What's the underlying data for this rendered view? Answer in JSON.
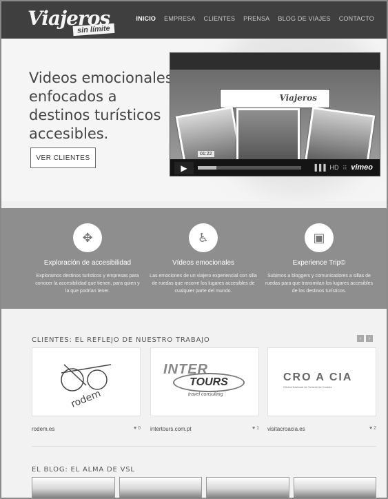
{
  "nav": {
    "logo_text": "Viajeros",
    "logo_tagline": "sin límite",
    "items": [
      "INICIO",
      "EMPRESA",
      "CLIENTES",
      "PRENSA",
      "BLOG DE VIAJES",
      "CONTACTO"
    ],
    "active_index": 0
  },
  "hero": {
    "title": "Videos emocionales enfocados a destinos turísticos accesibles.",
    "button_label": "VER CLIENTES"
  },
  "video": {
    "badge_text": "Viajeros",
    "time": "01:22",
    "progress": 0.18,
    "brand": "vimeo",
    "hd_label": "HD"
  },
  "features": [
    {
      "icon": "arrows-compress-icon",
      "title": "Exploración de accesibilidad",
      "text": "Exploramos destinos turísticos y empresas para conocer la accesibilidad que tienen, para quien y la que podrían tener."
    },
    {
      "icon": "wheelchair-icon",
      "title": "Vídeos emocionales",
      "text": "Las emociones de un viajero experiencial con silla de ruedas que recorre los lugares accesibles de cualquier parte del mundo."
    },
    {
      "icon": "video-camera-icon",
      "title": "Experience Trip©",
      "text": "Subimos a bloggers y comunicadores a sillas de ruedas para que transmitan los lugares accesibles de los destinos turísticos."
    }
  ],
  "clients": {
    "title": "CLIENTES: EL REFLEJO DE NUESTRO TRABAJO",
    "items": [
      {
        "name": "rodem.es",
        "likes": "0",
        "logo": "rodem"
      },
      {
        "name": "intertours.com.pt",
        "likes": "1",
        "logo_top": "INTER",
        "logo_mid": "TOURS",
        "logo_sub": "travel consulting"
      },
      {
        "name": "visitacroacia.es",
        "likes": "2",
        "logo_word": "CRO A CIA",
        "logo_sub": "Oficina Nacional de Turismo de Croacia"
      }
    ]
  },
  "blog": {
    "title": "EL BLOG: EL ALMA DE VSL"
  }
}
